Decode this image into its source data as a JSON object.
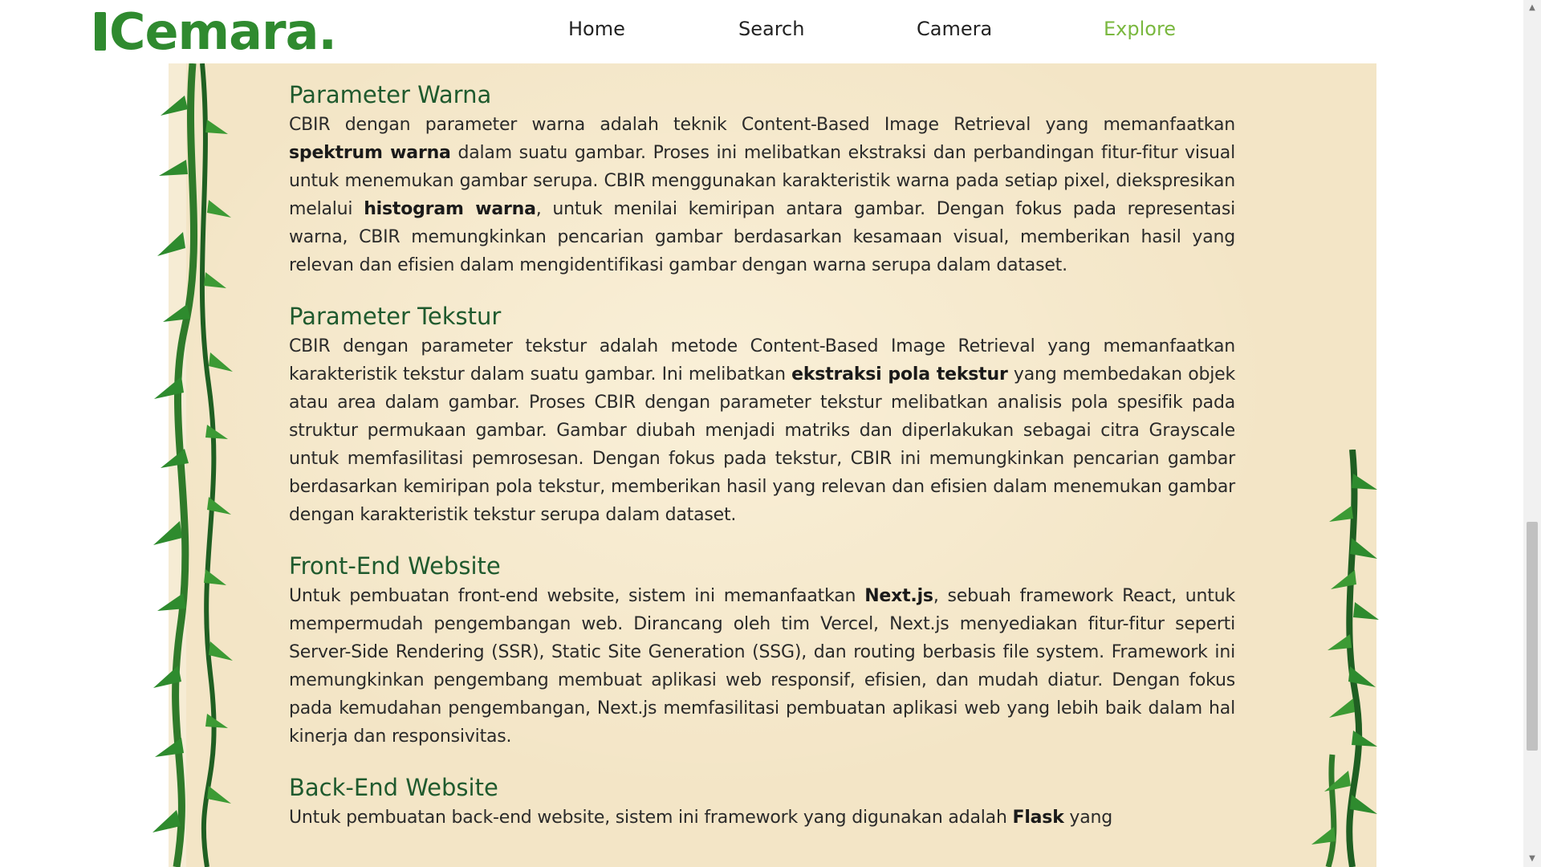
{
  "nav": {
    "logo": "Cemara.",
    "links": [
      "Home",
      "Search",
      "Camera",
      "Explore"
    ],
    "active": "Explore"
  },
  "sections": [
    {
      "title": "Parameter Warna",
      "paragraph": [
        {
          "t": "CBIR dengan parameter warna adalah teknik Content-Based Image Retrieval yang memanfaatkan "
        },
        {
          "t": "spektrum warna",
          "b": true
        },
        {
          "t": " dalam suatu gambar. Proses ini melibatkan ekstraksi dan perbandingan fitur-fitur visual untuk menemukan gambar serupa. CBIR menggunakan karakteristik warna pada setiap pixel, diekspresikan melalui "
        },
        {
          "t": "histogram warna",
          "b": true
        },
        {
          "t": ", untuk menilai kemiripan antara gambar. Dengan fokus pada representasi warna, CBIR memungkinkan pencarian gambar berdasarkan kesamaan visual, memberikan hasil yang relevan dan efisien dalam mengidentifikasi gambar dengan warna serupa dalam dataset."
        }
      ]
    },
    {
      "title": "Parameter Tekstur",
      "paragraph": [
        {
          "t": "CBIR dengan parameter tekstur adalah metode Content-Based Image Retrieval yang memanfaatkan karakteristik tekstur dalam suatu gambar. Ini melibatkan "
        },
        {
          "t": "ekstraksi pola tekstur",
          "b": true
        },
        {
          "t": " yang membedakan objek atau area dalam gambar. Proses CBIR dengan parameter tekstur melibatkan analisis pola spesifik pada struktur permukaan gambar. Gambar diubah menjadi matriks dan diperlakukan sebagai citra Grayscale untuk memfasilitasi pemrosesan. Dengan fokus pada tekstur, CBIR ini memungkinkan pencarian gambar berdasarkan kemiripan pola tekstur, memberikan hasil yang relevan dan efisien dalam menemukan gambar dengan karakteristik tekstur serupa dalam dataset."
        }
      ]
    },
    {
      "title": "Front-End Website",
      "paragraph": [
        {
          "t": "Untuk pembuatan front-end website, sistem ini memanfaatkan "
        },
        {
          "t": "Next.js",
          "b": true
        },
        {
          "t": ", sebuah framework React, untuk mempermudah pengembangan web. Dirancang oleh tim Vercel, Next.js menyediakan fitur-fitur seperti Server-Side Rendering (SSR), Static Site Generation (SSG), dan routing berbasis file system. Framework ini memungkinkan pengembang membuat aplikasi web responsif, efisien, dan mudah diatur. Dengan fokus pada kemudahan pengembangan, Next.js memfasilitasi pembuatan aplikasi web yang lebih baik dalam hal kinerja dan responsivitas."
        }
      ]
    },
    {
      "title": "Back-End Website",
      "paragraph": [
        {
          "t": "Untuk pembuatan back-end website, sistem ini framework yang digunakan adalah "
        },
        {
          "t": "Flask",
          "b": true
        },
        {
          "t": " yang"
        }
      ]
    }
  ],
  "colors": {
    "heading": "#1f5a2e",
    "active_link": "#7ab83f",
    "parchment": "#f3e5c6",
    "leaf": "#2f8a2f"
  },
  "icons": {
    "scroll_up": "triangle-up-icon",
    "scroll_down": "triangle-down-icon",
    "decoration": "vine-leaves-icon"
  }
}
